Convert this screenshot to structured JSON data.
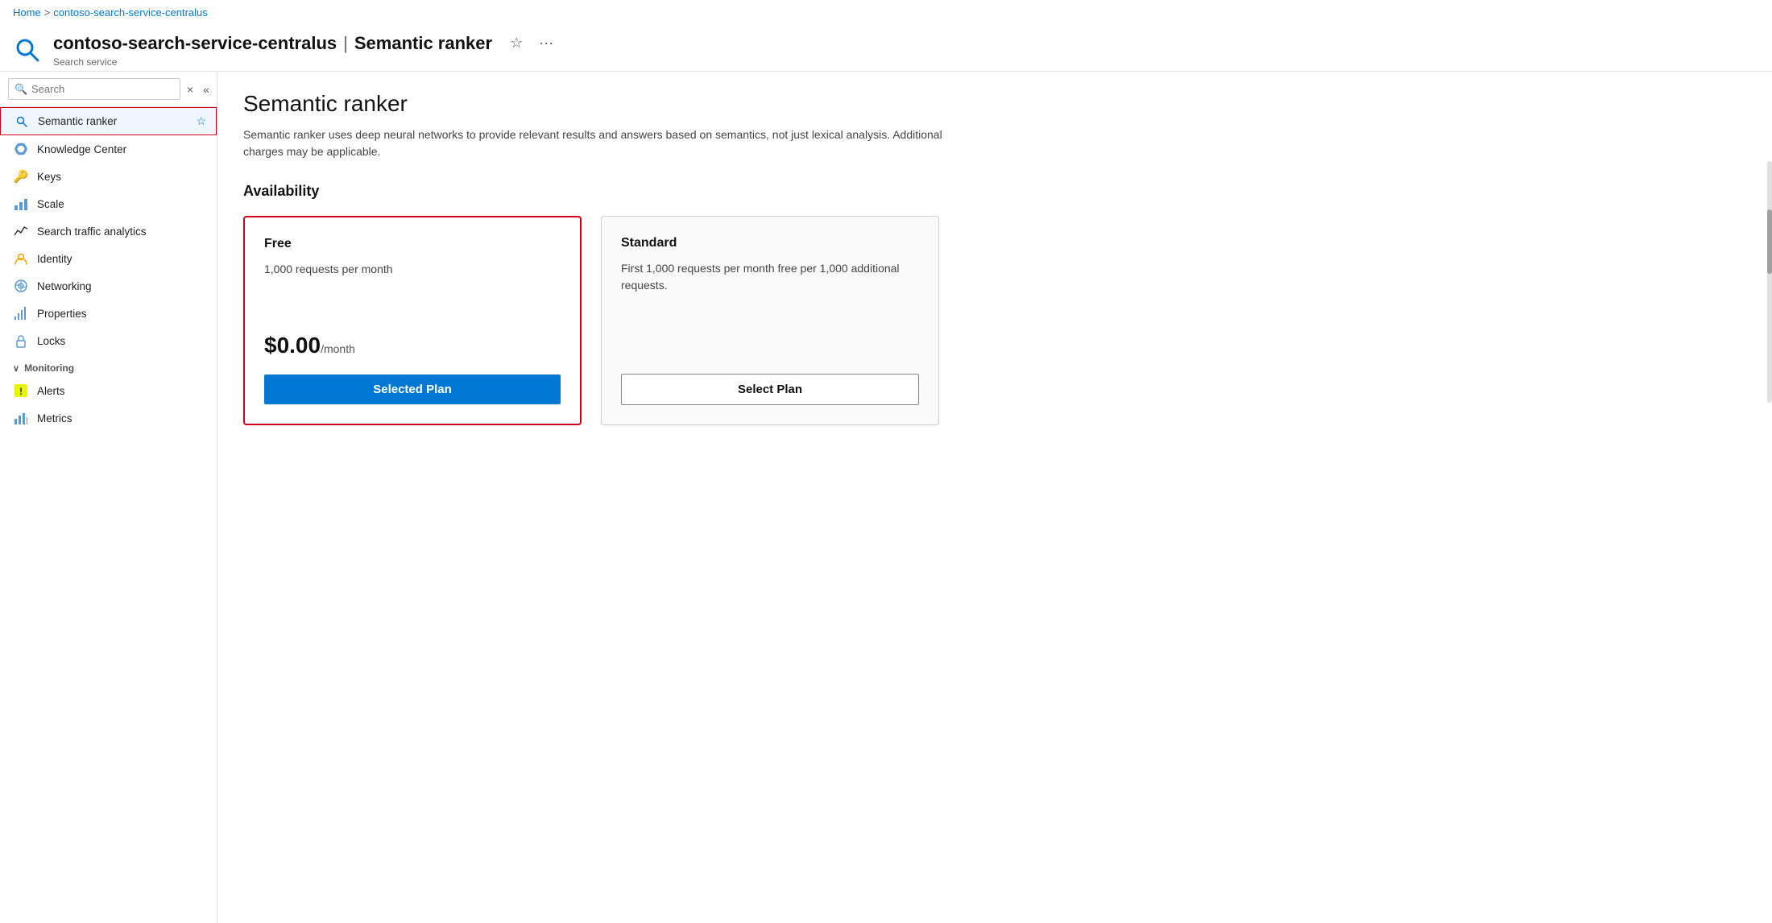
{
  "breadcrumb": {
    "home": "Home",
    "service": "contoso-search-service-centralus",
    "sep": ">"
  },
  "header": {
    "title": "contoso-search-service-centralus",
    "pipe": "|",
    "subtitle_part": "Semantic ranker",
    "service_type": "Search service",
    "star_icon": "☆",
    "more_icon": "···"
  },
  "sidebar": {
    "search_placeholder": "Search",
    "clear_btn": "×",
    "collapse_btn": "«",
    "items": [
      {
        "id": "semantic-ranker",
        "label": "Semantic ranker",
        "icon": "🔍",
        "active": true,
        "star": true
      },
      {
        "id": "knowledge-center",
        "label": "Knowledge Center",
        "icon": "☁️",
        "active": false
      },
      {
        "id": "keys",
        "label": "Keys",
        "icon": "🔑",
        "active": false
      },
      {
        "id": "scale",
        "label": "Scale",
        "icon": "📊",
        "active": false
      },
      {
        "id": "search-traffic-analytics",
        "label": "Search traffic analytics",
        "icon": "📈",
        "active": false
      },
      {
        "id": "identity",
        "label": "Identity",
        "icon": "🔐",
        "active": false
      },
      {
        "id": "networking",
        "label": "Networking",
        "icon": "🌐",
        "active": false
      },
      {
        "id": "properties",
        "label": "Properties",
        "icon": "📶",
        "active": false
      },
      {
        "id": "locks",
        "label": "Locks",
        "icon": "🔒",
        "active": false
      }
    ],
    "monitoring_section": "Monitoring",
    "monitoring_items": [
      {
        "id": "alerts",
        "label": "Alerts",
        "icon": "❗"
      },
      {
        "id": "metrics",
        "label": "Metrics",
        "icon": "📊"
      }
    ]
  },
  "content": {
    "title": "Semantic ranker",
    "description": "Semantic ranker uses deep neural networks to provide relevant results and answers based on semantics, not just lexical analysis. Additional charges may be applicable.",
    "availability_title": "Availability",
    "plans": [
      {
        "id": "free",
        "name": "Free",
        "description": "1,000 requests per month",
        "price_amount": "$0.00",
        "price_unit": "/month",
        "btn_label": "Selected Plan",
        "btn_type": "selected",
        "selected": true
      },
      {
        "id": "standard",
        "name": "Standard",
        "description": "First 1,000 requests per month free per 1,000 additional requests.",
        "price_amount": "",
        "price_unit": "",
        "btn_label": "Select Plan",
        "btn_type": "select",
        "selected": false
      }
    ]
  }
}
